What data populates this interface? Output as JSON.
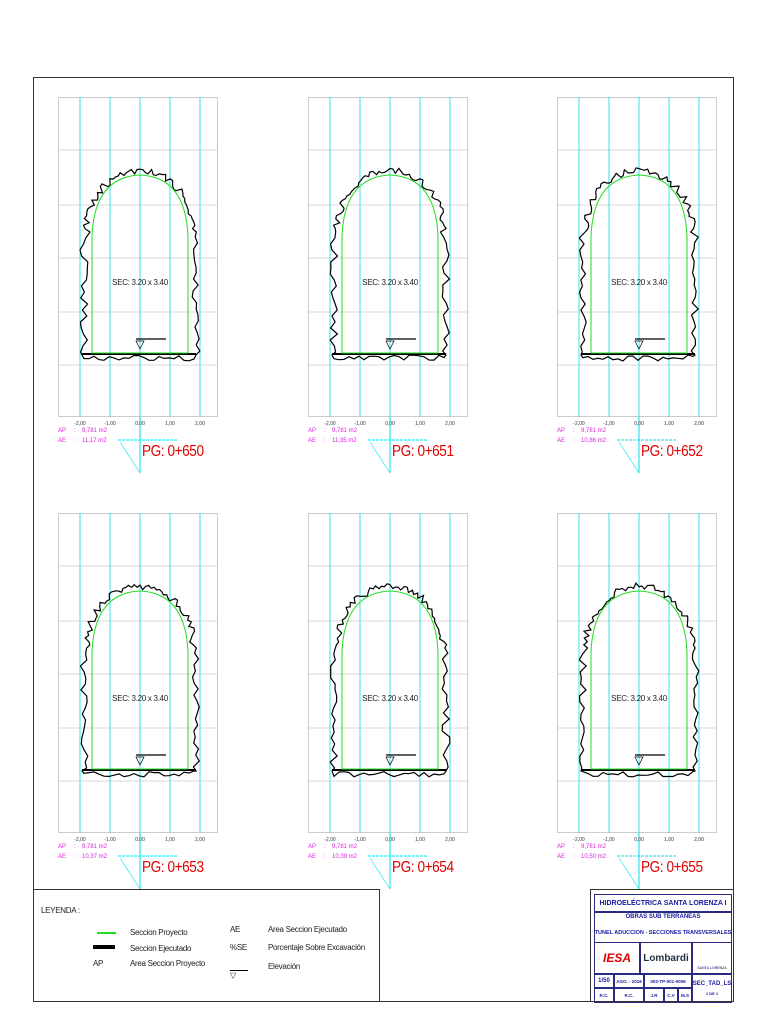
{
  "sections": [
    {
      "sec": "SEC: 3.20 x 3.40",
      "ap": "9,781 m2",
      "ae": "11,17 m2",
      "pg": "PG: 0+650"
    },
    {
      "sec": "SEC: 3.20 x 3.40",
      "ap": "9,781 m2",
      "ae": "11,35 m2",
      "pg": "PG: 0+651"
    },
    {
      "sec": "SEC: 3.20 x 3.40",
      "ap": "9,781 m2",
      "ae": "10,86 m2",
      "pg": "PG: 0+652"
    },
    {
      "sec": "SEC: 3.20 x 3.40",
      "ap": "9,781 m2",
      "ae": "10,37 m2",
      "pg": "PG: 0+653"
    },
    {
      "sec": "SEC: 3.20 x 3.40",
      "ap": "9,781 m2",
      "ae": "10,39 m2",
      "pg": "PG: 0+654"
    },
    {
      "sec": "SEC: 3.20 x 3.40",
      "ap": "9,781 m2",
      "ae": "10,50 m2",
      "pg": "PG: 0+655"
    }
  ],
  "ticks": [
    "-2,00",
    "-1,00",
    "0,00",
    "1,00",
    "2,00"
  ],
  "ap_label": "AP",
  "ae_label": "AE",
  "colon": ":",
  "legend": {
    "title": "LEYENDA :",
    "proyecto": "Seccion Proyecto",
    "ejecutado": "Seccion Ejecutado",
    "ap_abbr": "AP",
    "ap_desc": "Area Seccion Proyecto",
    "ae_abbr": "AE",
    "ae_desc": "Area Seccion Ejecutado",
    "se_abbr": "%SE",
    "se_desc": "Porcentaje Sobre Excavación",
    "elev_desc": "Elevación"
  },
  "colors": {
    "proyecto": "#22dd22",
    "ejecutado": "#000000",
    "grid": "#00e0f0",
    "pg": "#e00000",
    "areas": "#e020e0"
  },
  "title_block": {
    "project": "HIDROELÉCTRICA SANTA LORENZA I",
    "subtitle": "OBRAS SUB TERRANEAS",
    "drawing": "TUNEL ADUCCION - SECCIONES TRANSVERSALES",
    "logo1": "IESA",
    "logo2": "Lombardi",
    "logo3": "SANTA LORENZA",
    "scale": "1/50",
    "date": "AGO. - 2016",
    "code": "003-TP-001-0006",
    "sheet": "SEC_TAD_LS",
    "sheet_no": "1 DE 1",
    "sig": [
      "R.C.",
      "R.C.",
      "J.R",
      "C.V",
      "M.S"
    ]
  }
}
